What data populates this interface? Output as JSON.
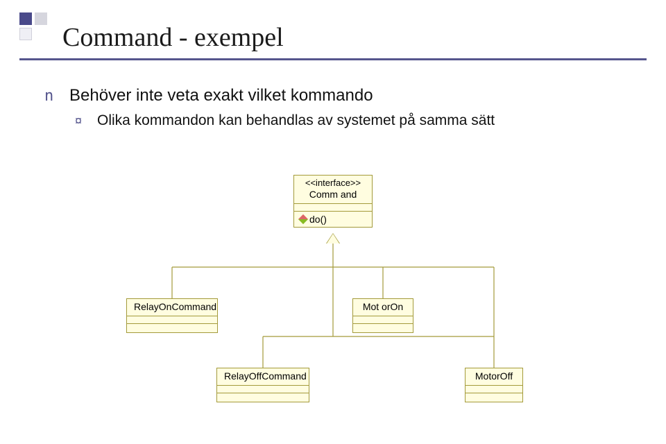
{
  "title": "Command - exempel",
  "bullet1": "Behöver inte veta exakt vilket kommando",
  "bullet2": "Olika kommandon kan behandlas av systemet på samma sätt",
  "interface": {
    "stereo": "<<interface>>",
    "name": "Comm and",
    "op": "do()"
  },
  "classes": {
    "relayOn": "RelayOnCommand",
    "motorOn": "Mot orOn",
    "relayOff": "RelayOffCommand",
    "motorOff": "MotorOff"
  }
}
